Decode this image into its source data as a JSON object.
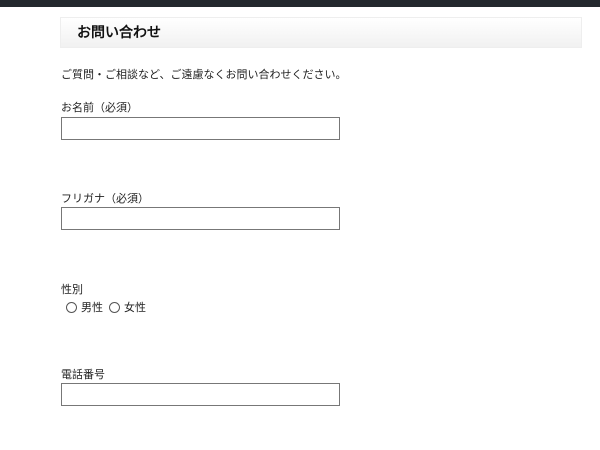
{
  "header": {
    "title": "お問い合わせ"
  },
  "intro": "ご質問・ご相談など、ご遠慮なくお問い合わせください。",
  "fields": {
    "name": {
      "label": "お名前（必須）",
      "value": ""
    },
    "furigana": {
      "label": "フリガナ（必須）",
      "value": ""
    },
    "gender": {
      "label": "性別",
      "options": [
        "男性",
        "女性"
      ]
    },
    "phone": {
      "label": "電話番号",
      "value": ""
    }
  }
}
